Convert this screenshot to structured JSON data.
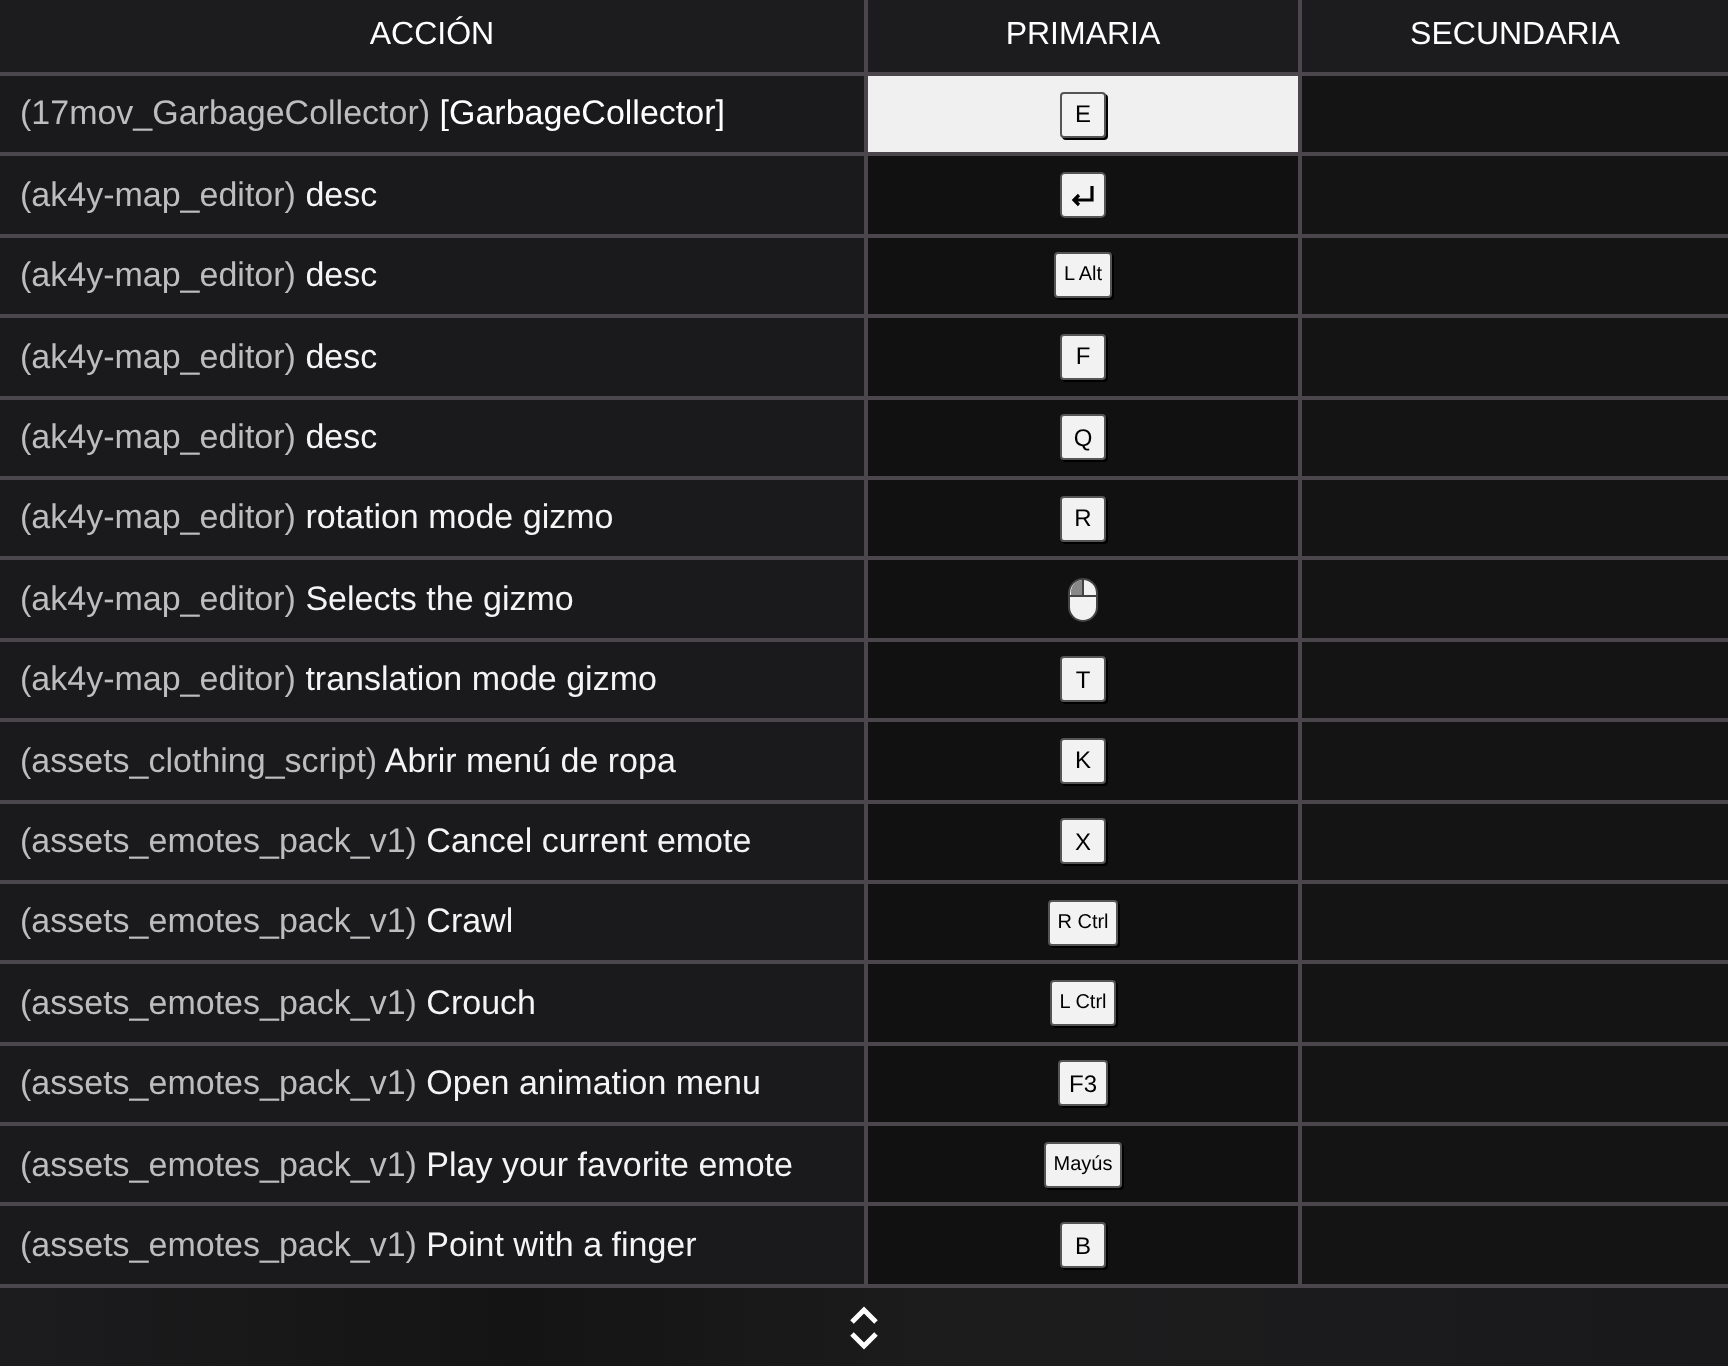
{
  "columns": [
    "ACCIÓN",
    "PRIMARIA",
    "SECUNDARIA"
  ],
  "rows": [
    {
      "resource": "(17mov_GarbageCollector)",
      "action": "[GarbageCollector]",
      "primary": {
        "kind": "key",
        "label": "E"
      },
      "selected": true
    },
    {
      "resource": "(ak4y-map_editor)",
      "action": "desc",
      "primary": {
        "kind": "enter"
      },
      "selected": false
    },
    {
      "resource": "(ak4y-map_editor)",
      "action": "desc",
      "primary": {
        "kind": "key",
        "label": "L Alt"
      },
      "selected": false
    },
    {
      "resource": "(ak4y-map_editor)",
      "action": "desc",
      "primary": {
        "kind": "key",
        "label": "F"
      },
      "selected": false
    },
    {
      "resource": "(ak4y-map_editor)",
      "action": "desc",
      "primary": {
        "kind": "key",
        "label": "Q"
      },
      "selected": false
    },
    {
      "resource": "(ak4y-map_editor)",
      "action": "rotation mode gizmo",
      "primary": {
        "kind": "key",
        "label": "R"
      },
      "selected": false
    },
    {
      "resource": "(ak4y-map_editor)",
      "action": "Selects the gizmo",
      "primary": {
        "kind": "mouse"
      },
      "selected": false
    },
    {
      "resource": "(ak4y-map_editor)",
      "action": "translation mode gizmo",
      "primary": {
        "kind": "key",
        "label": "T"
      },
      "selected": false
    },
    {
      "resource": "(assets_clothing_script)",
      "action": "Abrir menú de ropa",
      "primary": {
        "kind": "key",
        "label": "K"
      },
      "selected": false
    },
    {
      "resource": "(assets_emotes_pack_v1)",
      "action": "Cancel current emote",
      "primary": {
        "kind": "key",
        "label": "X"
      },
      "selected": false
    },
    {
      "resource": "(assets_emotes_pack_v1)",
      "action": "Crawl",
      "primary": {
        "kind": "key",
        "label": "R Ctrl"
      },
      "selected": false
    },
    {
      "resource": "(assets_emotes_pack_v1)",
      "action": "Crouch",
      "primary": {
        "kind": "key",
        "label": "L Ctrl"
      },
      "selected": false
    },
    {
      "resource": "(assets_emotes_pack_v1)",
      "action": "Open animation menu",
      "primary": {
        "kind": "key",
        "label": "F3"
      },
      "selected": false
    },
    {
      "resource": "(assets_emotes_pack_v1)",
      "action": "Play your favorite emote",
      "primary": {
        "kind": "key",
        "label": "Mayús"
      },
      "selected": false
    },
    {
      "resource": "(assets_emotes_pack_v1)",
      "action": "Point with a finger",
      "primary": {
        "kind": "key",
        "label": "B"
      },
      "selected": false
    }
  ]
}
